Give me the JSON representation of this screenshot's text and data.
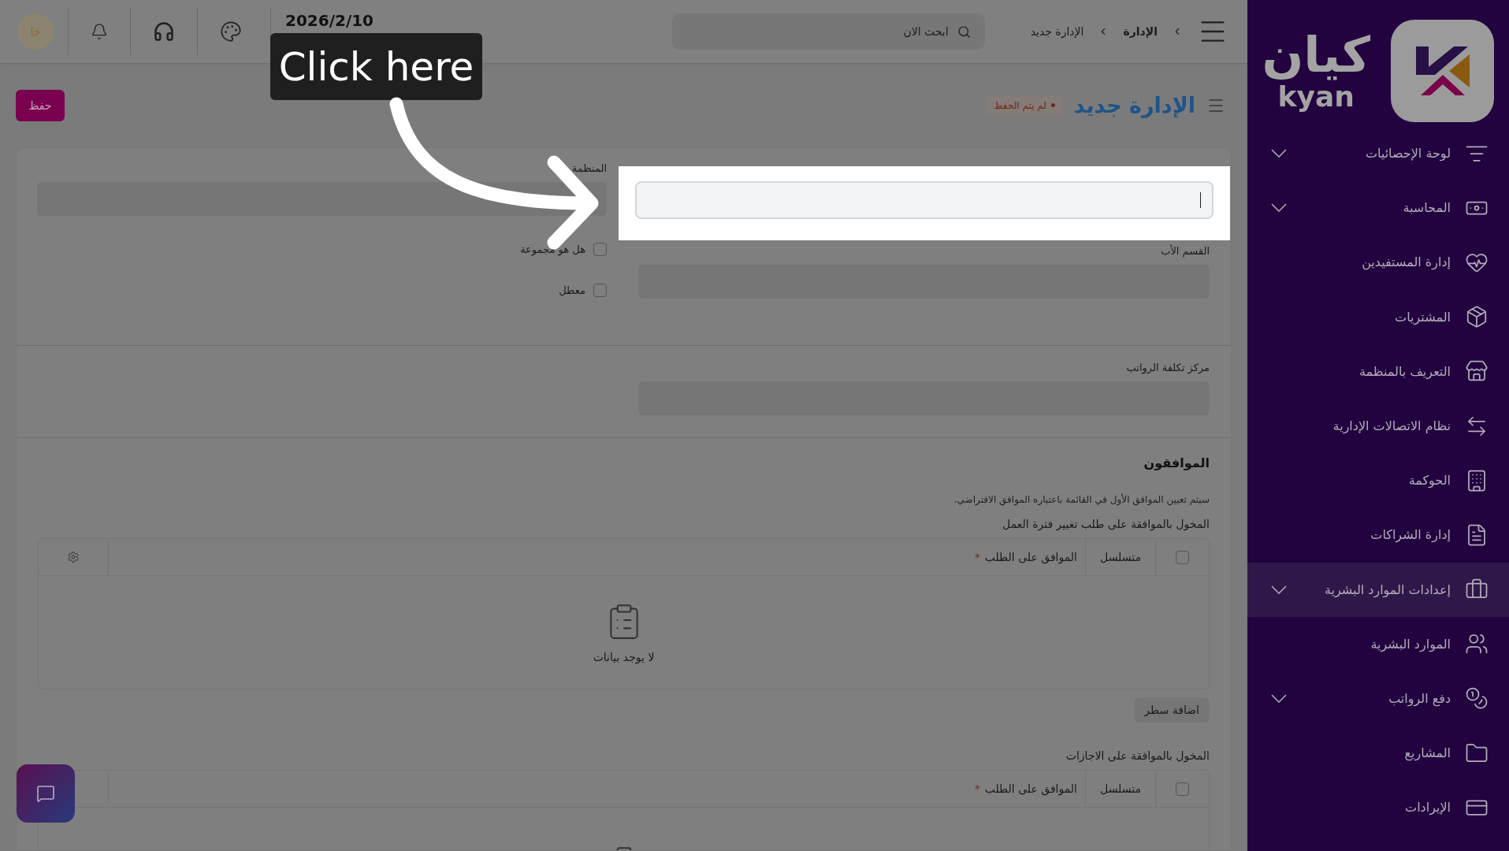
{
  "topbar": {
    "breadcrumb": [
      "الإدارة",
      "الإدارة جديد"
    ],
    "search": {
      "placeholder": "ابحث الان"
    },
    "date": "2026/2/10",
    "avatar": "خا"
  },
  "header": {
    "title": "الإدارة جديد",
    "status": "لم يتم الحفظ",
    "save": "حفظ"
  },
  "form": {
    "organization_label": "المنظمة",
    "parent_label": "القسم الأب",
    "checkboxes": [
      {
        "label": "هل هو مجموعة",
        "checked": false
      },
      {
        "label": "معطل",
        "checked": false
      }
    ],
    "cost_center_label": "مركز تكلفة الرواتب"
  },
  "approvers": {
    "title": "الموافقون",
    "note": "سيتم تعيين الموافق الأول في القائمة باعتباره الموافق الافتراضي.",
    "tables": [
      {
        "title": "المخول بالموافقة على طلب تغيير فترة العمل",
        "checked": false,
        "columns": [
          "متسلسل",
          "الموافق على الطلب"
        ],
        "required_mark": "*",
        "empty": "لا يوجد بيانات",
        "add_row": "اضافة سطر"
      },
      {
        "title": "المخول بالموافقة على الاجازات",
        "checked": false,
        "columns": [
          "متسلسل",
          "الموافق على الطلب"
        ],
        "required_mark": "*"
      }
    ]
  },
  "callout": {
    "text": "Click here"
  },
  "sidebar": {
    "logo_ar": "كيان",
    "logo_en": "kyan",
    "items": [
      {
        "label": "لوحة الإحصائيات",
        "expandable": true,
        "selected": false
      },
      {
        "label": "المحاسبة",
        "expandable": true,
        "selected": false
      },
      {
        "label": "إدارة المستفيدين",
        "expandable": false,
        "selected": false
      },
      {
        "label": "المشتريات",
        "expandable": false,
        "selected": false
      },
      {
        "label": "التعريف بالمنظمة",
        "expandable": false,
        "selected": false
      },
      {
        "label": "نظام الاتصالات الإدارية",
        "expandable": false,
        "selected": false
      },
      {
        "label": "الحوكمة",
        "expandable": false,
        "selected": false
      },
      {
        "label": "إدارة الشراكات",
        "expandable": false,
        "selected": false
      },
      {
        "label": "إعدادات الموارد البشرية",
        "expandable": true,
        "selected": true
      },
      {
        "label": "الموارد البشرية",
        "expandable": false,
        "selected": false
      },
      {
        "label": "دفع الرواتب",
        "expandable": true,
        "selected": false
      },
      {
        "label": "المشاريع",
        "expandable": false,
        "selected": false
      },
      {
        "label": "الإيرادات",
        "expandable": false,
        "selected": false
      }
    ]
  }
}
